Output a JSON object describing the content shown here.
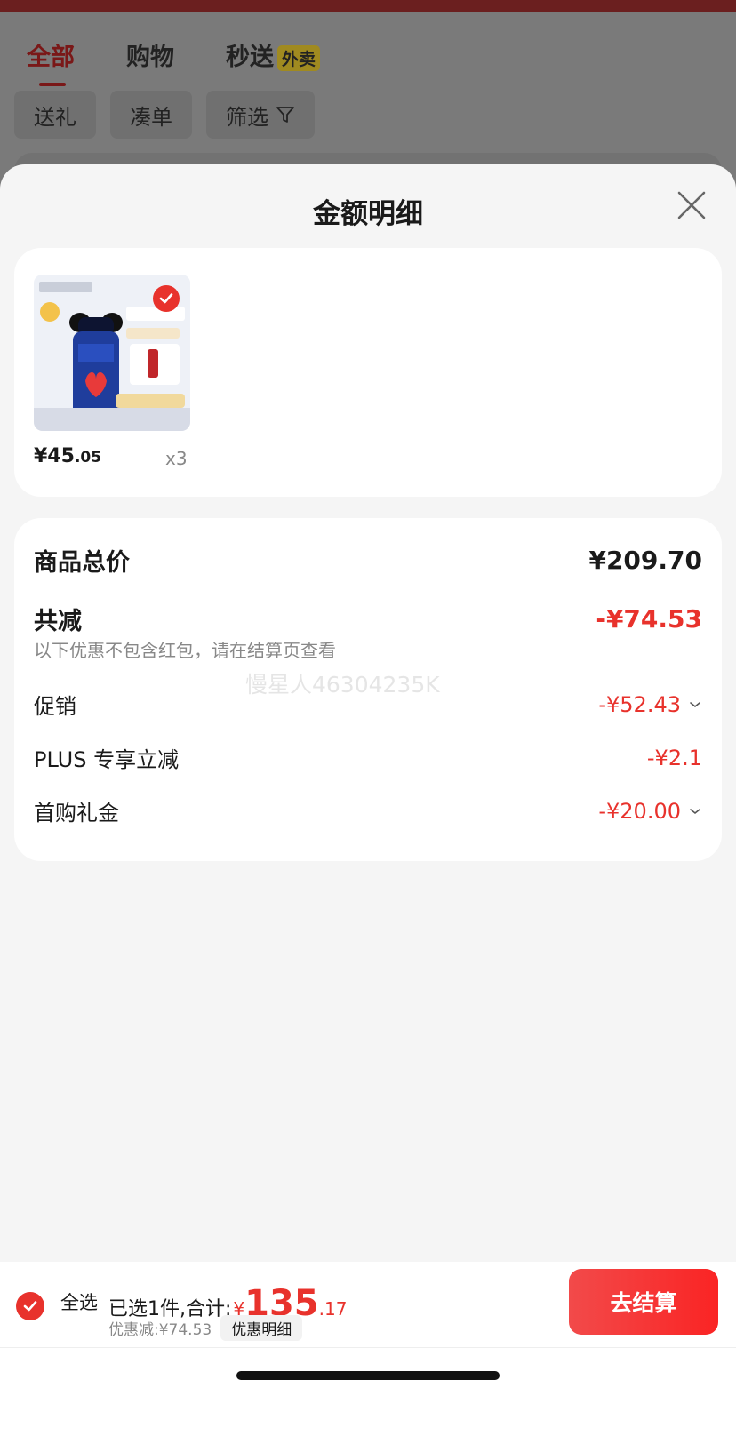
{
  "background": {
    "tabs": [
      {
        "label": "全部",
        "active": true
      },
      {
        "label": "购物",
        "active": false
      },
      {
        "label": "秒送",
        "active": false,
        "badge": "外卖"
      }
    ],
    "chips": [
      {
        "label": "送礼"
      },
      {
        "label": "凑单"
      },
      {
        "label": "筛选",
        "icon": "filter-icon"
      }
    ]
  },
  "sheet": {
    "title": "金额明细",
    "close_icon": "close-icon",
    "product": {
      "price_main": "¥45",
      "price_cents": ".05",
      "quantity": "x3",
      "selected": true
    },
    "summary": {
      "total_label": "商品总价",
      "total_value": "¥209.70",
      "reduction_label": "共减",
      "reduction_value": "-¥74.53",
      "note": "以下优惠不包含红包，请在结算页查看",
      "watermark": "慢星人46304235K",
      "items": [
        {
          "label": "促销",
          "value": "-¥52.43",
          "expandable": true
        },
        {
          "label": "PLUS 专享立减",
          "value": "-¥2.1",
          "expandable": false
        },
        {
          "label": "首购礼金",
          "value": "-¥20.00",
          "expandable": true
        }
      ]
    }
  },
  "bottom_bar": {
    "select_all": "全选",
    "selected_text": "已选1件,合计:",
    "currency": "¥",
    "total_int": "135",
    "total_dec": ".17",
    "discount_text": "优惠减:¥74.53",
    "detail_label": "优惠明细",
    "checkout_label": "去结算"
  },
  "colors": {
    "accent": "#e8322c",
    "sheet_bg": "#f5f5f5",
    "card_bg": "#ffffff"
  }
}
